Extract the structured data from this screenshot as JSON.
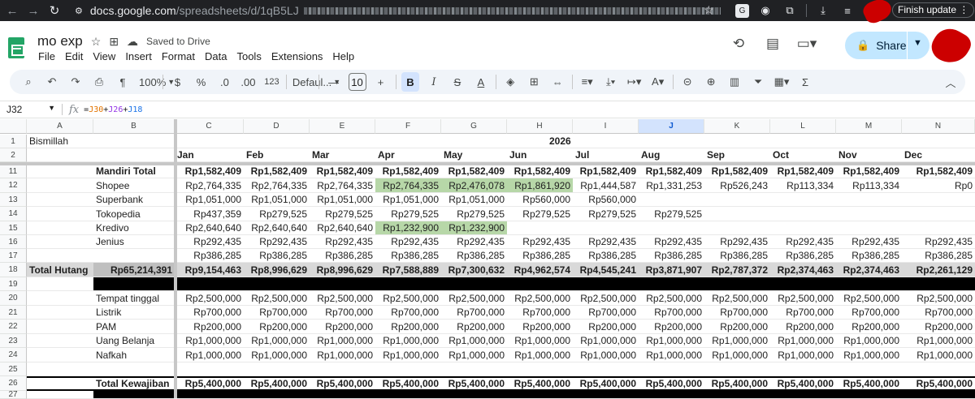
{
  "browser": {
    "url_host": "docs.google.com",
    "url_path": "/spreadsheets/d/1qB5LJ",
    "finish_update": "Finish update"
  },
  "doc": {
    "title": "mo exp",
    "saved": "Saved to Drive",
    "menus": [
      "File",
      "Edit",
      "View",
      "Insert",
      "Format",
      "Data",
      "Tools",
      "Extensions",
      "Help"
    ],
    "share_label": "Share"
  },
  "toolbar": {
    "zoom": "100%",
    "currency": "$",
    "percent": "%",
    "dec_decrease": ".0",
    "dec_increase": ".00",
    "number_format": "123",
    "font": "Defaul...",
    "font_size": "10",
    "bold": "B",
    "italic": "I"
  },
  "formula_bar": {
    "cell_ref": "J32",
    "formula_parts": [
      "=",
      "J30",
      "+",
      "J26",
      "+",
      "J18"
    ]
  },
  "columns": [
    "A",
    "B",
    "C",
    "D",
    "E",
    "F",
    "G",
    "H",
    "I",
    "J",
    "K",
    "L",
    "M",
    "N"
  ],
  "selected_column": "J",
  "row_numbers": [
    "1",
    "2",
    "11",
    "12",
    "13",
    "14",
    "15",
    "16",
    "17",
    "18",
    "19",
    "20",
    "21",
    "22",
    "23",
    "24",
    "25",
    "26",
    "27"
  ],
  "cells": {
    "a1": "Bismillah",
    "year": "2026",
    "months": [
      "Jan",
      "Feb",
      "Mar",
      "Apr",
      "May",
      "Jun",
      "Jul",
      "Aug",
      "Sep",
      "Oct",
      "Nov",
      "Dec"
    ],
    "debts": [
      {
        "label": "Mandiri Total",
        "bold": true,
        "values": [
          "Rp1,582,409",
          "Rp1,582,409",
          "Rp1,582,409",
          "Rp1,582,409",
          "Rp1,582,409",
          "Rp1,582,409",
          "Rp1,582,409",
          "Rp1,582,409",
          "Rp1,582,409",
          "Rp1,582,409",
          "Rp1,582,409",
          "Rp1,582,409"
        ]
      },
      {
        "label": "Shopee",
        "values": [
          "Rp2,764,335",
          "Rp2,764,335",
          "Rp2,764,335",
          "Rp2,764,335",
          "Rp2,476,078",
          "Rp1,861,920",
          "Rp1,444,587",
          "Rp1,331,253",
          "Rp526,243",
          "Rp113,334",
          "Rp113,334",
          "Rp0"
        ],
        "green": [
          3,
          4,
          5
        ]
      },
      {
        "label": "Superbank",
        "values": [
          "Rp1,051,000",
          "Rp1,051,000",
          "Rp1,051,000",
          "Rp1,051,000",
          "Rp1,051,000",
          "Rp560,000",
          "Rp560,000",
          "",
          "",
          "",
          "",
          ""
        ]
      },
      {
        "label": "Tokopedia",
        "values": [
          "Rp437,359",
          "Rp279,525",
          "Rp279,525",
          "Rp279,525",
          "Rp279,525",
          "Rp279,525",
          "Rp279,525",
          "Rp279,525",
          "",
          "",
          "",
          ""
        ]
      },
      {
        "label": "Kredivo",
        "values": [
          "Rp2,640,640",
          "Rp2,640,640",
          "Rp2,640,640",
          "Rp1,232,900",
          "Rp1,232,900",
          "",
          "",
          "",
          "",
          "",
          "",
          ""
        ],
        "green": [
          3,
          4
        ]
      },
      {
        "label": "Jenius",
        "values": [
          "Rp292,435",
          "Rp292,435",
          "Rp292,435",
          "Rp292,435",
          "Rp292,435",
          "Rp292,435",
          "Rp292,435",
          "Rp292,435",
          "Rp292,435",
          "Rp292,435",
          "Rp292,435",
          "Rp292,435"
        ]
      },
      {
        "label": "",
        "values": [
          "Rp386,285",
          "Rp386,285",
          "Rp386,285",
          "Rp386,285",
          "Rp386,285",
          "Rp386,285",
          "Rp386,285",
          "Rp386,285",
          "Rp386,285",
          "Rp386,285",
          "Rp386,285",
          "Rp386,285"
        ]
      }
    ],
    "total_hutang": {
      "label": "Total Hutang",
      "grand": "Rp65,214,391",
      "values": [
        "Rp9,154,463",
        "Rp8,996,629",
        "Rp8,996,629",
        "Rp7,588,889",
        "Rp7,300,632",
        "Rp4,962,574",
        "Rp4,545,241",
        "Rp3,871,907",
        "Rp2,787,372",
        "Rp2,374,463",
        "Rp2,374,463",
        "Rp2,261,129"
      ]
    },
    "obligations": [
      {
        "label": "Tempat tinggal",
        "value": "Rp2,500,000"
      },
      {
        "label": "Listrik",
        "value": "Rp700,000"
      },
      {
        "label": "PAM",
        "value": "Rp200,000"
      },
      {
        "label": "Uang Belanja",
        "value": "Rp1,000,000"
      },
      {
        "label": "Nafkah",
        "value": "Rp1,000,000"
      }
    ],
    "total_kewajiban": {
      "label": "Total Kewajiban",
      "value": "Rp5,400,000"
    }
  }
}
